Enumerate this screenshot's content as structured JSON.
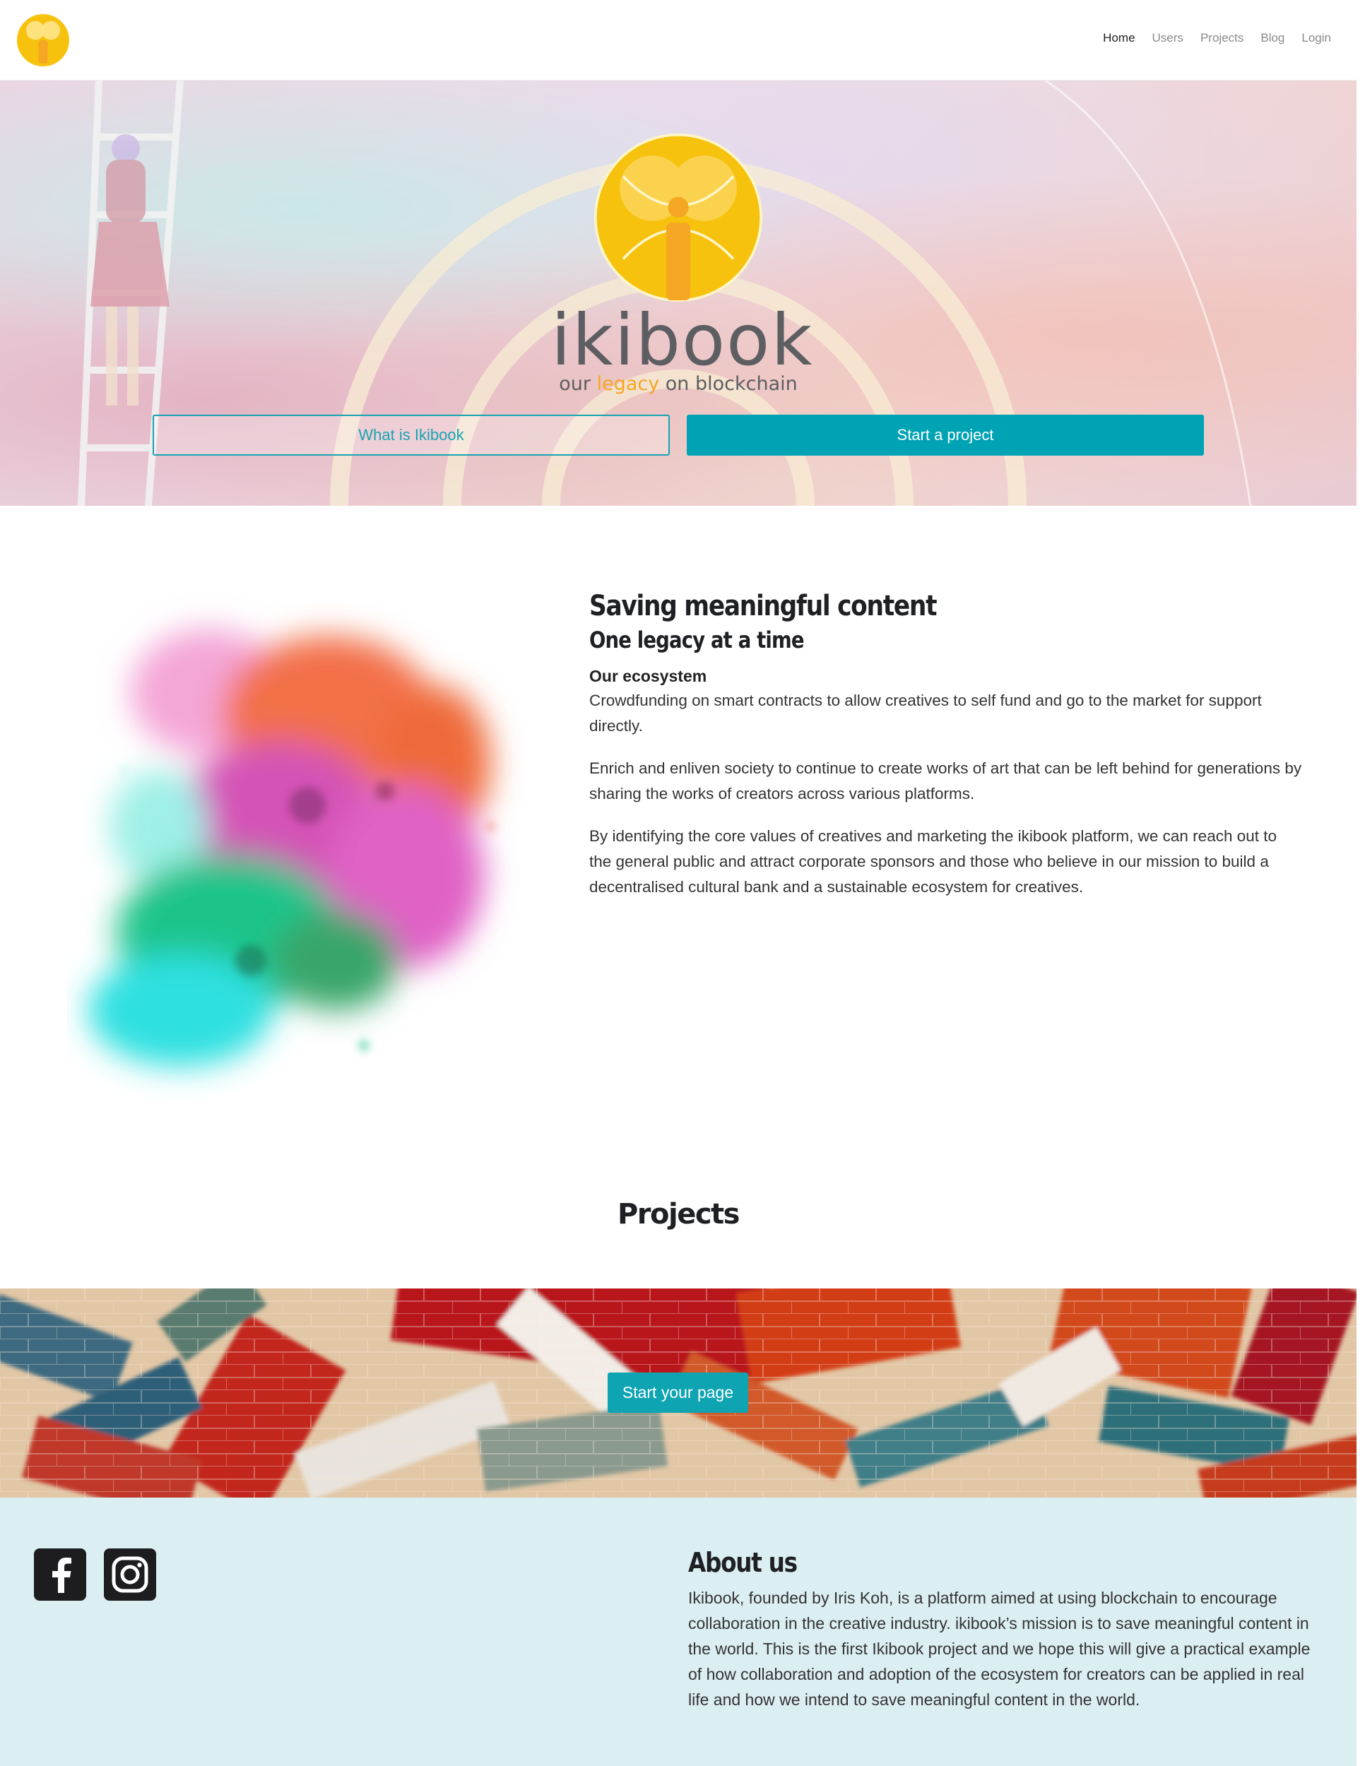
{
  "nav": {
    "logo_icon": "ikibook-logo-icon",
    "links": [
      {
        "label": "Home",
        "active": true
      },
      {
        "label": "Users",
        "active": false
      },
      {
        "label": "Projects",
        "active": false
      },
      {
        "label": "Blog",
        "active": false
      },
      {
        "label": "Login",
        "active": false
      }
    ]
  },
  "hero": {
    "wordmark": "ikibook",
    "tagline_pre": "our ",
    "tagline_accent": "legacy",
    "tagline_post": " on blockchain",
    "btn_what": "What is Ikibook",
    "btn_start": "Start a project"
  },
  "content": {
    "title": "Saving meaningful content",
    "subtitle": "One legacy at a time",
    "eco_heading": "Our ecosystem",
    "paragraphs": [
      "Crowdfunding on smart contracts to allow creatives to self fund and go to the market for support directly.",
      "Enrich and enliven society to continue to create works of art that can be left behind for generations by sharing the works of creators across various platforms.",
      "By identifying the core values of creatives and marketing the ikibook platform, we can reach out to the general public and attract corporate sponsors and those who believe in our mission to build a decentralised cultural bank and a sustainable ecosystem for creatives."
    ]
  },
  "projects": {
    "title": "Projects",
    "btn_start_page": "Start your page"
  },
  "footer": {
    "social": [
      "facebook-icon",
      "instagram-icon"
    ],
    "about_title": "About us",
    "about_text": "Ikibook, founded by Iris Koh, is a platform aimed at using blockchain to encourage collaboration in the creative industry. ikibook’s mission is to save meaningful content in the world. This is the first Ikibook project and we hope this will give a practical example of how collaboration and adoption of the ecosystem for creators can be applied in real life and how we intend to save meaningful content in the world."
  },
  "colors": {
    "brand_teal": "#00a3b4",
    "brand_yellow": "#f7c20d",
    "brand_orange": "#f5a623",
    "footer_bg": "#dbeef2"
  }
}
